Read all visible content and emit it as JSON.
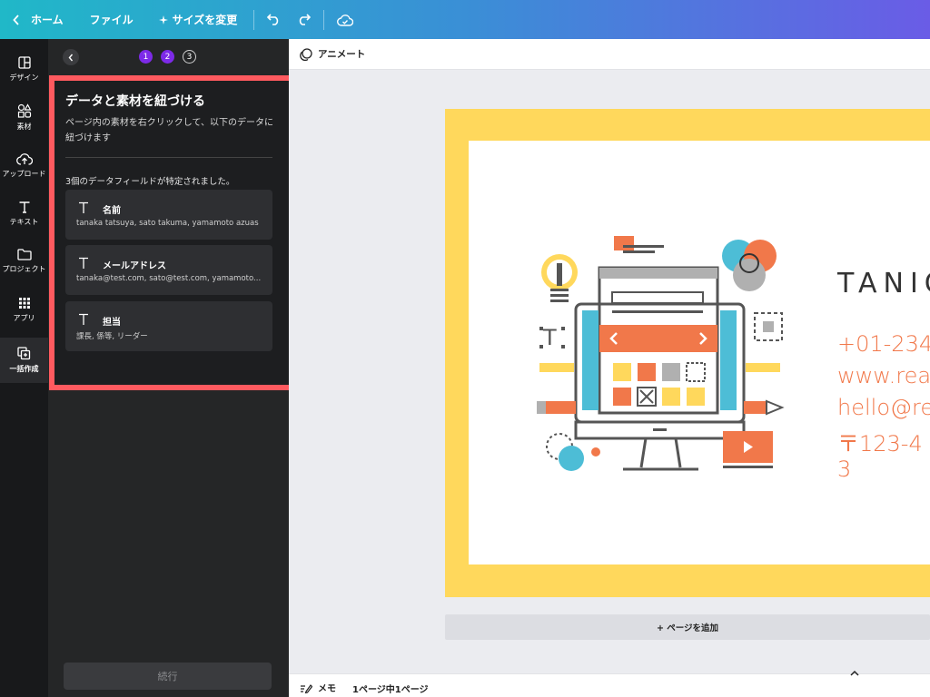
{
  "topbar": {
    "home": "ホーム",
    "file": "ファイル",
    "resize": "サイズを変更"
  },
  "rail": {
    "items": [
      {
        "label": "デザイン",
        "icon": "layout-icon"
      },
      {
        "label": "素材",
        "icon": "shapes-icon"
      },
      {
        "label": "アップロード",
        "icon": "cloud-upload-icon"
      },
      {
        "label": "テキスト",
        "icon": "text-icon"
      },
      {
        "label": "プロジェクト",
        "icon": "folder-icon"
      },
      {
        "label": "アプリ",
        "icon": "apps-grid-icon"
      },
      {
        "label": "一括作成",
        "icon": "bulk-create-icon"
      }
    ]
  },
  "panel": {
    "steps": [
      "1",
      "2",
      "3"
    ],
    "title": "データと素材を紐づける",
    "description": "ページ内の素材を右クリックして、以下のデータに紐づけます",
    "count_text": "3個のデータフィールドが特定されました。",
    "fields": [
      {
        "name": "名前",
        "values": "tanaka tatsuya, sato takuma, yamamoto azuas"
      },
      {
        "name": "メールアドレス",
        "values": "tanaka@test.com, sato@test.com, yamamoto..."
      },
      {
        "name": "担当",
        "values": "課長, 係等, リーダー"
      }
    ],
    "continue_label": "続行"
  },
  "canvas": {
    "animate_label": "アニメート",
    "card": {
      "name": "TANIG",
      "contact": [
        "+01-234",
        "www.rea",
        "hello@re",
        "〒123-4",
        "3"
      ]
    },
    "add_page_label": "+ ページを追加"
  },
  "bottombar": {
    "memo_label": "メモ",
    "page_count": "1ページ中1ページ"
  },
  "colors": {
    "accent_purple": "#7d2ae8",
    "highlight_red": "#ff5a5f",
    "card_yellow": "#ffd85c",
    "contact_orange": "#f1784a"
  }
}
